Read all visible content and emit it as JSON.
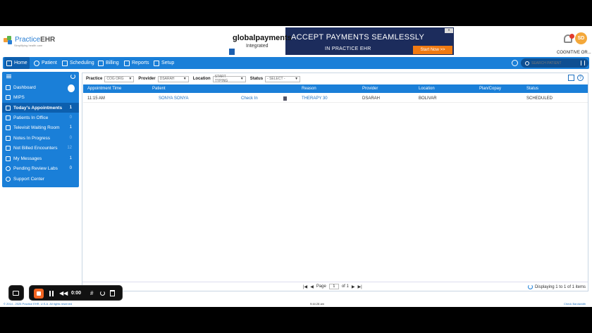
{
  "header": {
    "logo_brand": "Practice",
    "logo_ehr": "EHR",
    "logo_tagline": "Simplifying health care",
    "user_initials": "SD",
    "practice_name": "COGNITIVE OR..."
  },
  "ad": {
    "brand": "globalpayments",
    "brand_sub": "Integrated",
    "headline": "ACCEPT PAYMENTS SEAMLESSLY",
    "subline": "IN PRACTICE EHR",
    "cta": "Start Now >>"
  },
  "nav": {
    "items": [
      {
        "label": "Home",
        "icon": "home-icon"
      },
      {
        "label": "Patient",
        "icon": "patient-icon"
      },
      {
        "label": "Scheduling",
        "icon": "calendar-icon"
      },
      {
        "label": "Billing",
        "icon": "billing-icon"
      },
      {
        "label": "Reports",
        "icon": "reports-icon"
      },
      {
        "label": "Setup",
        "icon": "setup-icon"
      }
    ],
    "search_placeholder": "SEARCH PATIENT"
  },
  "sidebar": {
    "items": [
      {
        "label": "Dashboard",
        "count": ""
      },
      {
        "label": "MIPS",
        "count": ""
      },
      {
        "label": "Today's Appointments",
        "count": "1"
      },
      {
        "label": "Patients In Office",
        "count": "0"
      },
      {
        "label": "Televisit Waiting Room",
        "count": "1"
      },
      {
        "label": "Notes In Progress",
        "count": "0"
      },
      {
        "label": "Not Billed Encounters",
        "count": "12"
      },
      {
        "label": "My Messages",
        "count": "1"
      },
      {
        "label": "Pending Review Labs",
        "count": "0"
      },
      {
        "label": "Support Center",
        "count": ""
      }
    ]
  },
  "filters": {
    "practice_label": "Practice",
    "practice_value": "COG ORG",
    "provider_label": "Provider",
    "provider_value": "DSARAH",
    "location_label": "Location",
    "location_placeholder": "START TYPING",
    "status_label": "Status",
    "status_value": "- SELECT -"
  },
  "table": {
    "columns": [
      "Appointment Time",
      "Patient",
      "Reason",
      "Provider",
      "Location",
      "Plan/Copay",
      "Status"
    ],
    "rows": [
      {
        "time": "11:15 AM",
        "patient": "SONYA SONYA",
        "action": "Check In",
        "reason": "THERAPY 30",
        "provider": "DSARAH",
        "location": "BOLIVAR",
        "plan": "",
        "status": "SCHEDULED"
      }
    ]
  },
  "pager": {
    "page_label": "Page",
    "page_value": "1",
    "of_label": "of 1",
    "summary": "Displaying 1 to 1 of 1 items"
  },
  "footer": {
    "copyright": "© 2014 - 2025 Practice EHR, U.S.A. All rights reserved",
    "time": "9:44:28 am",
    "bandwidth": "Check Bandwidth"
  },
  "recorder": {
    "time": "0:00"
  }
}
